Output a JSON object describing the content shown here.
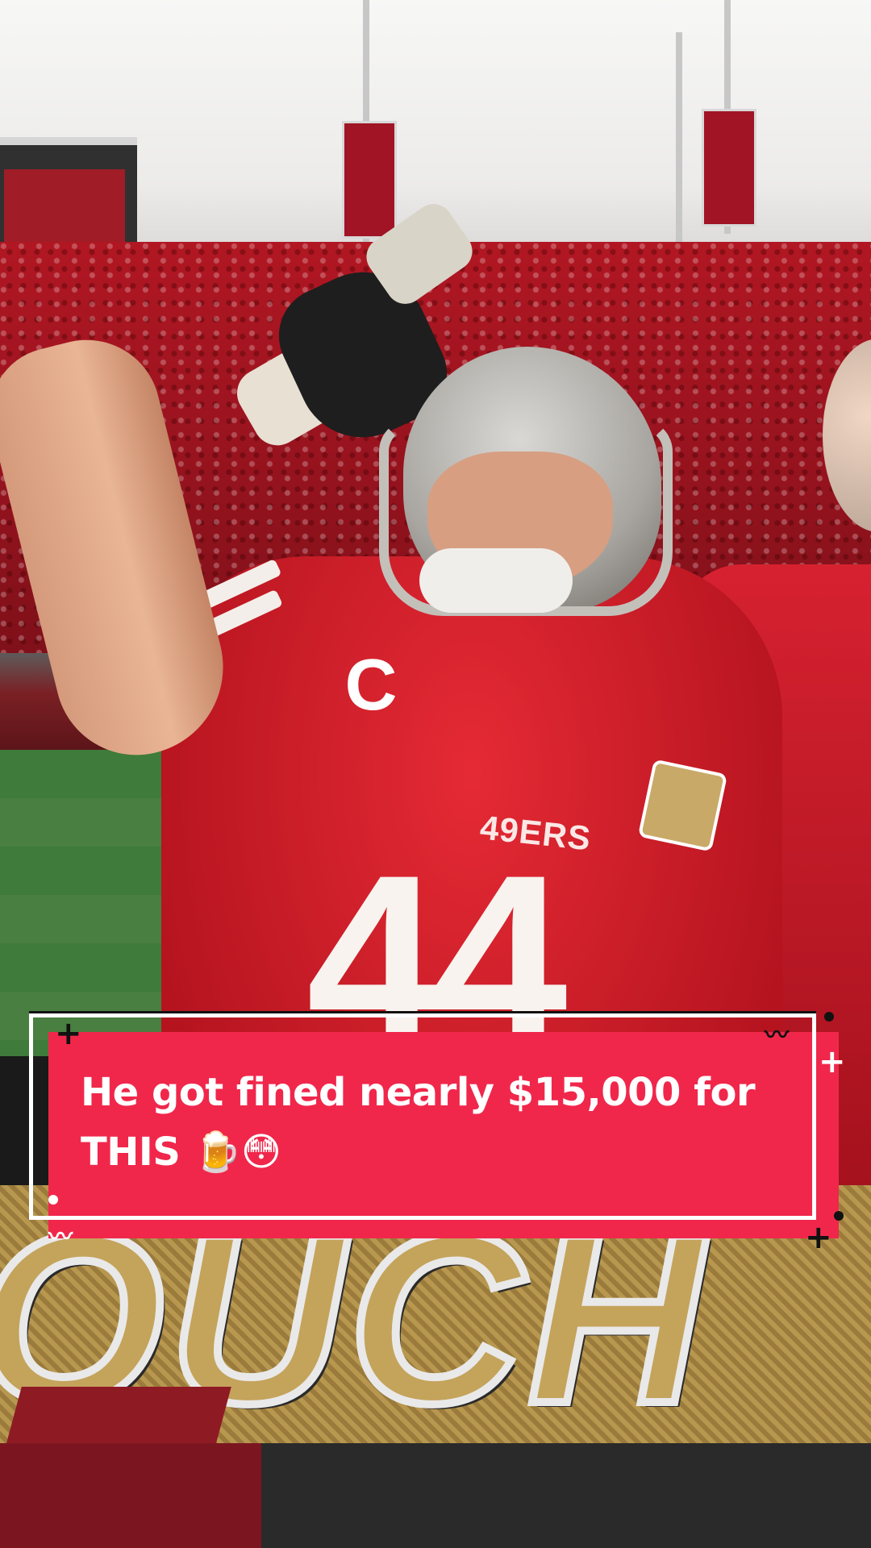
{
  "video": {
    "caption": {
      "line1": "He got fined nearly $15,000 for",
      "line2": "THIS 🍺😳"
    },
    "jersey": {
      "captain_patch": "C",
      "wordmark": "49ERS",
      "number": "44"
    },
    "overlay_graphic_text": "OUCH",
    "colors": {
      "caption_background": "#f0274b",
      "caption_text": "#ffffff",
      "jersey_red": "#c8141f",
      "graphic_gold": "#c4a35b"
    }
  }
}
